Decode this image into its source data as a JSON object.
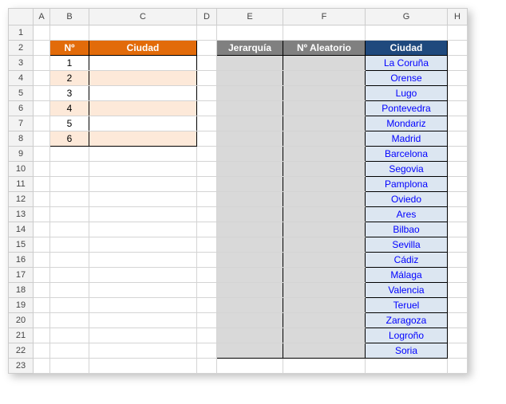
{
  "columns": [
    "A",
    "B",
    "C",
    "D",
    "E",
    "F",
    "G",
    "H"
  ],
  "row_count": 23,
  "selected_column": "F",
  "left_table": {
    "header_no": "Nº",
    "header_ciudad": "Ciudad",
    "rows": [
      {
        "no": "1",
        "ciudad": ""
      },
      {
        "no": "2",
        "ciudad": ""
      },
      {
        "no": "3",
        "ciudad": ""
      },
      {
        "no": "4",
        "ciudad": ""
      },
      {
        "no": "5",
        "ciudad": ""
      },
      {
        "no": "6",
        "ciudad": ""
      }
    ]
  },
  "right_table": {
    "header_jerarquia": "Jerarquía",
    "header_aleatorio": "Nº Aleatorio",
    "header_ciudad": "Ciudad",
    "cities": [
      "La Coruña",
      "Orense",
      "Lugo",
      "Pontevedra",
      "Mondariz",
      "Madrid",
      "Barcelona",
      "Segovia",
      "Pamplona",
      "Oviedo",
      "Ares",
      "Bilbao",
      "Sevilla",
      "Cádiz",
      "Málaga",
      "Valencia",
      "Teruel",
      "Zaragoza",
      "Logroño",
      "Soria"
    ]
  }
}
